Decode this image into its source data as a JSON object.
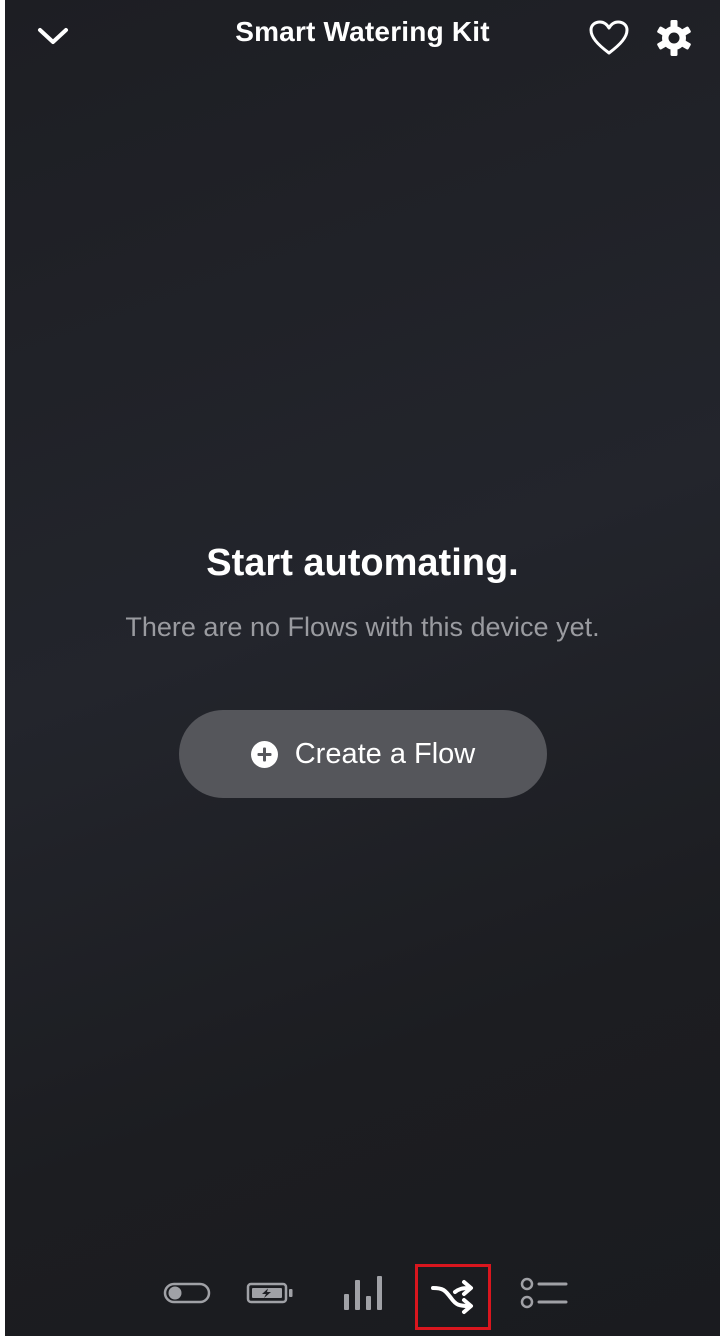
{
  "header": {
    "title": "Smart Watering Kit",
    "back_icon": "chevron-down-icon",
    "favorite_icon": "heart-outline-icon",
    "settings_icon": "gear-icon"
  },
  "empty_state": {
    "title": "Start automating.",
    "subtitle": "There are no Flows with this device yet.",
    "button_label": "Create a Flow",
    "button_icon": "plus-circle-icon"
  },
  "tabs": [
    {
      "name": "controls",
      "icon": "toggle-icon",
      "active": false
    },
    {
      "name": "energy",
      "icon": "battery-icon",
      "active": false
    },
    {
      "name": "insights",
      "icon": "bar-chart-icon",
      "active": false
    },
    {
      "name": "flows",
      "icon": "shuffle-icon",
      "active": true
    },
    {
      "name": "details",
      "icon": "list-icon",
      "active": false
    }
  ],
  "colors": {
    "background": "#1e1f24",
    "button_bg": "#55565b",
    "subtitle": "#9a9ba0",
    "active_highlight": "#d9161e",
    "icon_inactive": "#a0a1a6"
  }
}
